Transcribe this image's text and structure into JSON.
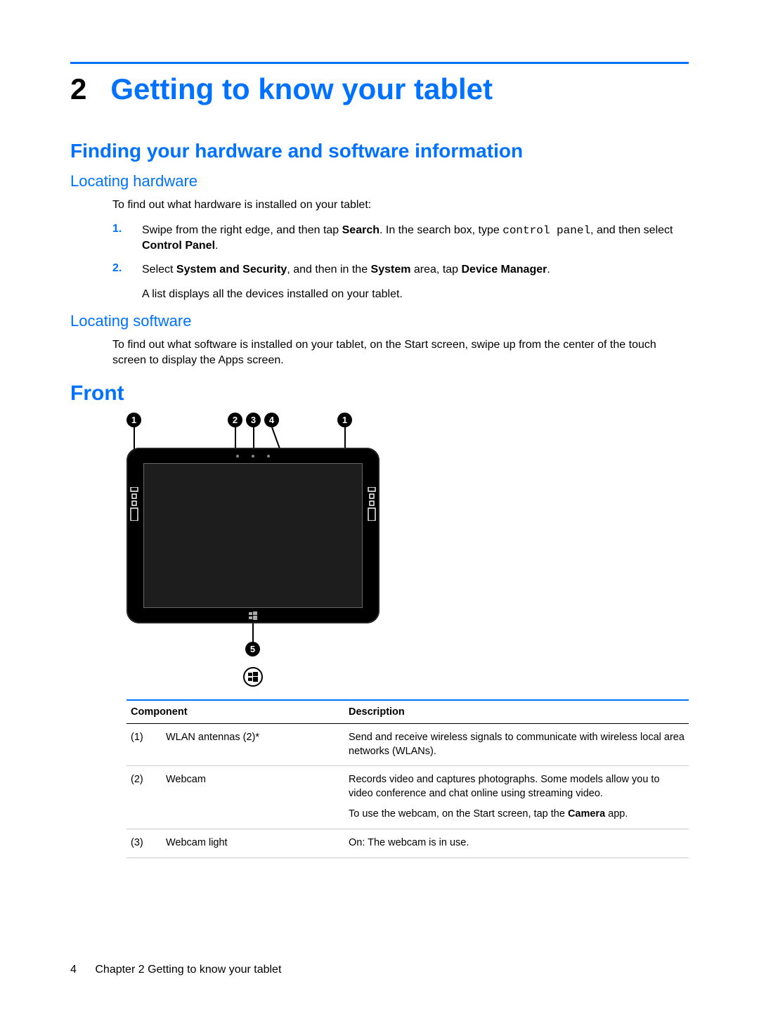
{
  "chapter": {
    "number": "2",
    "title": "Getting to know your tablet"
  },
  "section1": {
    "title": "Finding your hardware and software information",
    "sub_hardware": {
      "title": "Locating hardware",
      "intro": "To find out what hardware is installed on your tablet:",
      "step1_num": "1.",
      "step1_a": "Swipe from the right edge, and then tap ",
      "step1_bold1": "Search",
      "step1_b": ". In the search box, type ",
      "step1_mono": "control panel",
      "step1_c": ", and then select ",
      "step1_bold2": "Control Panel",
      "step1_d": ".",
      "step2_num": "2.",
      "step2_a": "Select ",
      "step2_bold1": "System and Security",
      "step2_b": ", and then in the ",
      "step2_bold2": "System",
      "step2_c": " area, tap ",
      "step2_bold3": "Device Manager",
      "step2_d": ".",
      "step2_after": "A list displays all the devices installed on your tablet."
    },
    "sub_software": {
      "title": "Locating software",
      "body": "To find out what software is installed on your tablet, on the Start screen, swipe up from the center of the touch screen to display the Apps screen."
    }
  },
  "section2": {
    "title": "Front"
  },
  "callouts": {
    "c1": "1",
    "c2": "2",
    "c3": "3",
    "c4": "4",
    "c5": "5"
  },
  "table": {
    "head_component": "Component",
    "head_description": "Description",
    "rows": [
      {
        "num": "(1)",
        "name": "WLAN antennas (2)*",
        "desc": "Send and receive wireless signals to communicate with wireless local area networks (WLANs)."
      },
      {
        "num": "(2)",
        "name": "Webcam",
        "desc": "Records video and captures photographs. Some models allow you to video conference and chat online using streaming video.",
        "sub_a": "To use the webcam, on the Start screen, tap the ",
        "sub_bold": "Camera",
        "sub_b": " app."
      },
      {
        "num": "(3)",
        "name": "Webcam light",
        "desc": "On: The webcam is in use."
      }
    ]
  },
  "footer": {
    "page": "4",
    "text": "Chapter 2   Getting to know your tablet"
  }
}
